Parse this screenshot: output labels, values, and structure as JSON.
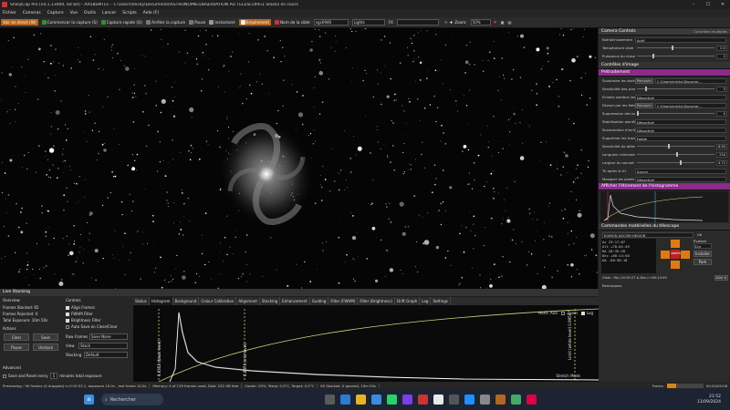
{
  "window": {
    "title": "SharpCap Pro (v4.1.13000, 64 bit) - AA5BSMTEC - C:\\Users\\micky\\Documents\\ASTRONOMIE\\OBSERVATION AU TELESCOPE\\1 Stacks en cours"
  },
  "menu": [
    "Fichier",
    "Cameras",
    "Capture",
    "Vue",
    "Outils",
    "Lancer",
    "Scripts",
    "Aide (F)"
  ],
  "toolbar": {
    "live_view": "Voir en direct (W)",
    "start_capture": "Commencer la capture (S)",
    "quick_capture": "Capture rapide (Q)",
    "stop_capture": "Arrêter la capture",
    "pause": "Pause",
    "snapshot": "Instantané",
    "stacking": "Empilement",
    "target_label": "Nom de la cible",
    "target_value": "ngc6946",
    "frame_type": "Lights",
    "fx_label": "FX",
    "zoom_label": "Zoom:",
    "zoom_value": "50%"
  },
  "camera_controls": {
    "title": "Camera Controls",
    "options_label": "Contrôles multiples",
    "refresh_label": "Rafraîchissement",
    "refresh_value": "Actif",
    "temp_label": "Température cible",
    "temp_value": "0.0",
    "heater_label": "Puissance du chauffage de fenêtre",
    "heater_value": "2"
  },
  "image_controls": {
    "title": "Contrôles d'image",
    "preprocess": "Prétraitement",
    "dark_label": "Soustraire les darks",
    "browse": "Parcourir",
    "dark_path": "C:\\Users\\micky\\Docume...",
    "hot_label": "Sensibilité des pixels chauds",
    "hot_value": "5",
    "cold_label": "Échelle sombre (expérimentale)",
    "cold_value": "Désactivé",
    "flat_label": "Diviser par les flats",
    "flat_path": "C:\\Users\\micky\\Docume...",
    "banding_label": "Suppression des bandes",
    "banding_value": "0",
    "flat_stab_label": "Stabilisation planéité / disque",
    "flat_stab_value": "Désactivé",
    "bg_label": "Soustraction d'arrière-plan",
    "bg_value": "Désactivé",
    "trails_label": "Supprimer les traces satellites",
    "trails_value": "Faible",
    "fwhm1_label": "Sensibilité de détection du",
    "fwhm1_value": "8.60",
    "min_label": "Longueur minimale du",
    "min_value": "234",
    "max_label": "Largeur du sonnet",
    "max_value": "4.72",
    "cull_label": "Tri après le tri",
    "cull_value": "Aucun",
    "mask_label": "Masquer les pixels exposés",
    "mask_value": "Désactivé"
  },
  "histogram_panel": {
    "title": "Afficher l'étirement de l'histogramme"
  },
  "mount": {
    "title": "Commandes matérielles du télescope",
    "mount_name": "EQMOD ASCOM HEQ5/6",
    "ar_label": "Az",
    "ar_value": "23:17:07",
    "alt_label": "Alt",
    "alt_value": "+70:01:49",
    "ra_label": "RA",
    "ra_value": "20:35:28",
    "dec_label": "Dec",
    "dec_value": "+60:14:50",
    "ha_label": "HA",
    "ha_value": "-00:58:18",
    "evaluate": "Évaluer",
    "rate_value": "32x",
    "use_label": "Uti",
    "install": "Installer",
    "stop_btn": "ARRÊTER",
    "track": "Suivi",
    "park": "Park",
    "target_line": "Cible : RA=20:35:27 & Dec=+60:14:59",
    "remarks": "Remarques",
    "goto": "Aller à"
  },
  "live_stacking": {
    "title": "Live Stacking",
    "overview": "Overview",
    "frames_stacked_label": "Frames Stacked:",
    "frames_stacked_value": "65",
    "frames_rejected_label": "Frames Rejected:",
    "frames_rejected_value": "0",
    "total_exposure_label": "Total Exposure:",
    "total_exposure_value": "10m 50s",
    "actions": "Actions",
    "clear": "Clear",
    "save": "Save",
    "pause": "Pause",
    "unstack": "Unstack",
    "advanced": "Advanced",
    "save_reset": "Save and Reset every",
    "save_reset_num": "5",
    "save_reset_unit": "minutes total exposure",
    "controls": "Controls",
    "align_frames": "Align Frames",
    "fwhm_filter": "FWHM Filter",
    "brightness_filter": "Brightness Filter",
    "auto_save": "Auto Save on Close/Clear",
    "raw_frames_label": "Raw Frames",
    "raw_frames_value": "Save None",
    "view_label": "View",
    "view_value": "Stack",
    "stacking_label": "Stacking",
    "stacking_value": "Default"
  },
  "tabs": [
    "Status",
    "Histogram",
    "Background",
    "Colour Calibration",
    "Alignment",
    "Stacking",
    "Enhancement",
    "Guiding",
    "Filter (FWHM)",
    "Filter (Brightness)",
    "Drift Graph",
    "Log",
    "Settings"
  ],
  "histogram": {
    "horiz_axis": "Horiz. Axis",
    "zoom": "Zoom",
    "log": "Log",
    "stretch_mode": "Stretch Mode",
    "mark1": "0.0152 (black level)",
    "mark2": "0.2674 (mid level)",
    "mark3": "Limit (white level) 0.9950"
  },
  "status_bar": [
    "Previewing : 90 frames (0 dropped) in 0:15:53.1, exposure 10.0s , last frame 10.0s",
    "Memory: 4 of 129 frames used, Disk: 232 GB free",
    "Cooler: 29%, Temp: 0.0°C, Target: 0.0°C",
    "65 Stacked, 0 ignored, 10m 50s"
  ],
  "frame_progress_label": "Frame:",
  "frame_progress_value": "00:02/00:08",
  "taskbar": {
    "search": "Rechercher",
    "time": "21:52",
    "date": "11/09/2024"
  },
  "colors": {
    "accent": "#b5651d",
    "purple": "#8b2b8b",
    "histogram_line": "#d6d27a"
  }
}
